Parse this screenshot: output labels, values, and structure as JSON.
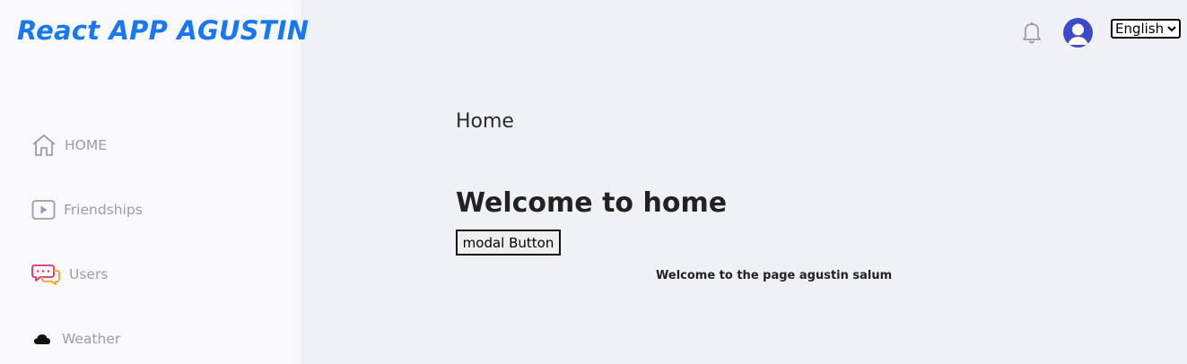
{
  "brand": {
    "title": "React APP AGUSTIN"
  },
  "sidebar": {
    "items": [
      {
        "label": "HOME",
        "icon": "home-icon"
      },
      {
        "label": "Friendships",
        "icon": "play-icon"
      },
      {
        "label": "Users",
        "icon": "chat-bubbles-icon"
      },
      {
        "label": "Weather",
        "icon": "cloud-icon"
      }
    ]
  },
  "header": {
    "notification_icon": "bell-icon",
    "avatar_icon": "user-avatar-icon",
    "language": {
      "selected": "English",
      "options": [
        "English"
      ]
    }
  },
  "main": {
    "page_title": "Home",
    "welcome_heading": "Welcome to home",
    "modal_button_label": "modal Button",
    "footer_text": "Welcome to the page agustin salum"
  },
  "colors": {
    "brand": "#1877f2",
    "sidebar_bg": "#f9f9fc",
    "main_bg": "#f0f1f6",
    "nav_text": "#9a9cb0",
    "avatar": "#3d4ac7"
  }
}
